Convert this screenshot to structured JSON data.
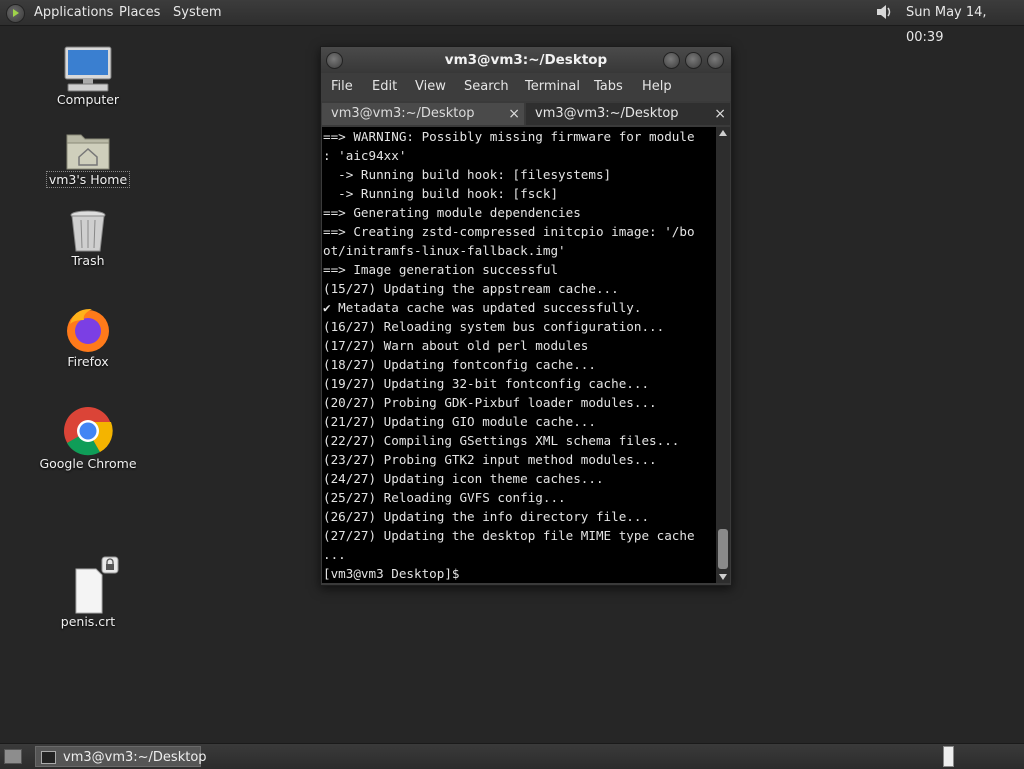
{
  "top_panel": {
    "menus": [
      "Applications",
      "Places",
      "System"
    ],
    "clock": "Sun May 14, 00:39"
  },
  "desktop_icons": [
    {
      "label": "Computer",
      "icon": "computer-icon"
    },
    {
      "label": "vm3's Home",
      "icon": "home-folder-icon"
    },
    {
      "label": "Trash",
      "icon": "trash-icon"
    },
    {
      "label": "Firefox",
      "icon": "firefox-icon"
    },
    {
      "label": "Google Chrome",
      "icon": "chrome-icon"
    },
    {
      "label": "penis.crt",
      "icon": "file-icon"
    }
  ],
  "terminal": {
    "title": "vm3@vm3:~/Desktop",
    "menu": [
      "File",
      "Edit",
      "View",
      "Search",
      "Terminal",
      "Tabs",
      "Help"
    ],
    "tabs": [
      {
        "label": "vm3@vm3:~/Desktop",
        "close": "×"
      },
      {
        "label": "vm3@vm3:~/Desktop",
        "close": "×"
      }
    ],
    "lines": [
      "==> WARNING: Possibly missing firmware for module",
      ": 'aic94xx'",
      "  -> Running build hook: [filesystems]",
      "  -> Running build hook: [fsck]",
      "==> Generating module dependencies",
      "==> Creating zstd-compressed initcpio image: '/bo",
      "ot/initramfs-linux-fallback.img'",
      "==> Image generation successful",
      "(15/27) Updating the appstream cache...",
      "✔ Metadata cache was updated successfully.",
      "(16/27) Reloading system bus configuration...",
      "(17/27) Warn about old perl modules",
      "(18/27) Updating fontconfig cache...",
      "(19/27) Updating 32-bit fontconfig cache...",
      "(20/27) Probing GDK-Pixbuf loader modules...",
      "(21/27) Updating GIO module cache...",
      "(22/27) Compiling GSettings XML schema files...",
      "(23/27) Probing GTK2 input method modules...",
      "(24/27) Updating icon theme caches...",
      "(25/27) Reloading GVFS config...",
      "(26/27) Updating the info directory file...",
      "(27/27) Updating the desktop file MIME type cache",
      "...",
      "[vm3@vm3 Desktop]$ "
    ]
  },
  "taskbar": {
    "task_label": "vm3@vm3:~/Desktop"
  }
}
